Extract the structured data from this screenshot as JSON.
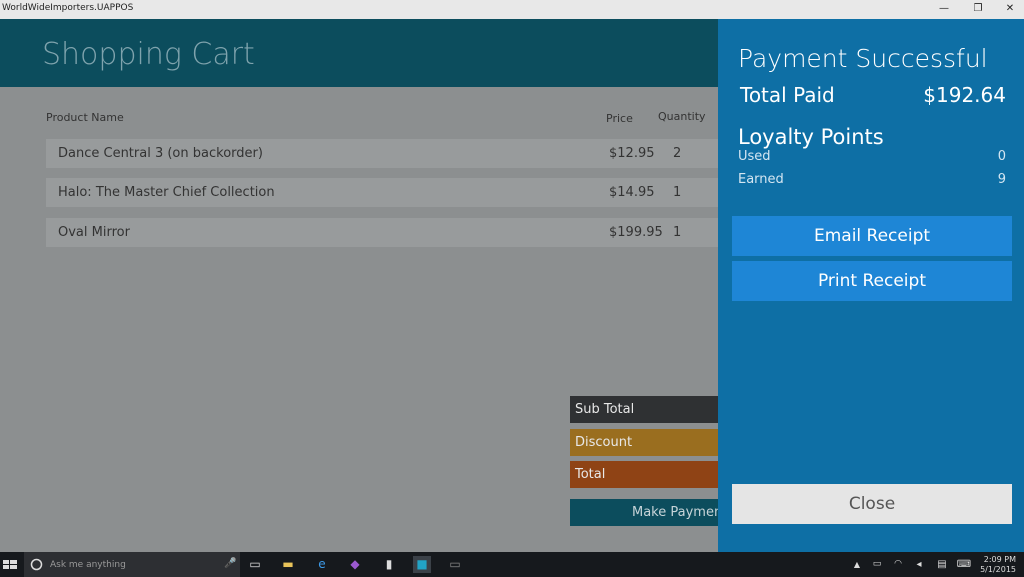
{
  "window": {
    "title": "WorldWideImporters.UAPPOS",
    "buttons": {
      "minimize": "—",
      "restore": "❐",
      "close": "✕"
    }
  },
  "cart": {
    "title": "Shopping Cart",
    "columns": {
      "product": "Product Name",
      "price": "Price",
      "quantity": "Quantity"
    },
    "items": [
      {
        "name": "Dance Central 3 (on backorder)",
        "price": "$12.95",
        "qty": "2"
      },
      {
        "name": "Halo: The Master Chief Collection",
        "price": "$14.95",
        "qty": "1"
      },
      {
        "name": "Oval Mirror",
        "price": "$199.95",
        "qty": "1"
      }
    ],
    "summary": {
      "subtotal": "Sub Total",
      "discount": "Discount",
      "total": "Total"
    },
    "make_payment": "Make Paymen"
  },
  "payment_panel": {
    "title": "Payment Successful",
    "total_paid_label": "Total Paid",
    "total_paid_value": "$192.64",
    "loyalty_title": "Loyalty Points",
    "used_label": "Used",
    "used_value": "0",
    "earned_label": "Earned",
    "earned_value": "9",
    "email_receipt": "Email Receipt",
    "print_receipt": "Print Receipt",
    "close": "Close"
  },
  "taskbar": {
    "search_placeholder": "Ask me anything",
    "time": "2:09 PM",
    "date": "5/1/2015"
  },
  "colors": {
    "header_bg": "#0c4d5d",
    "panel_bg": "#0e6fa5",
    "button_bg": "#1e86d6",
    "discount_bg": "#9a6e1f",
    "total_bg": "#8f4315"
  }
}
